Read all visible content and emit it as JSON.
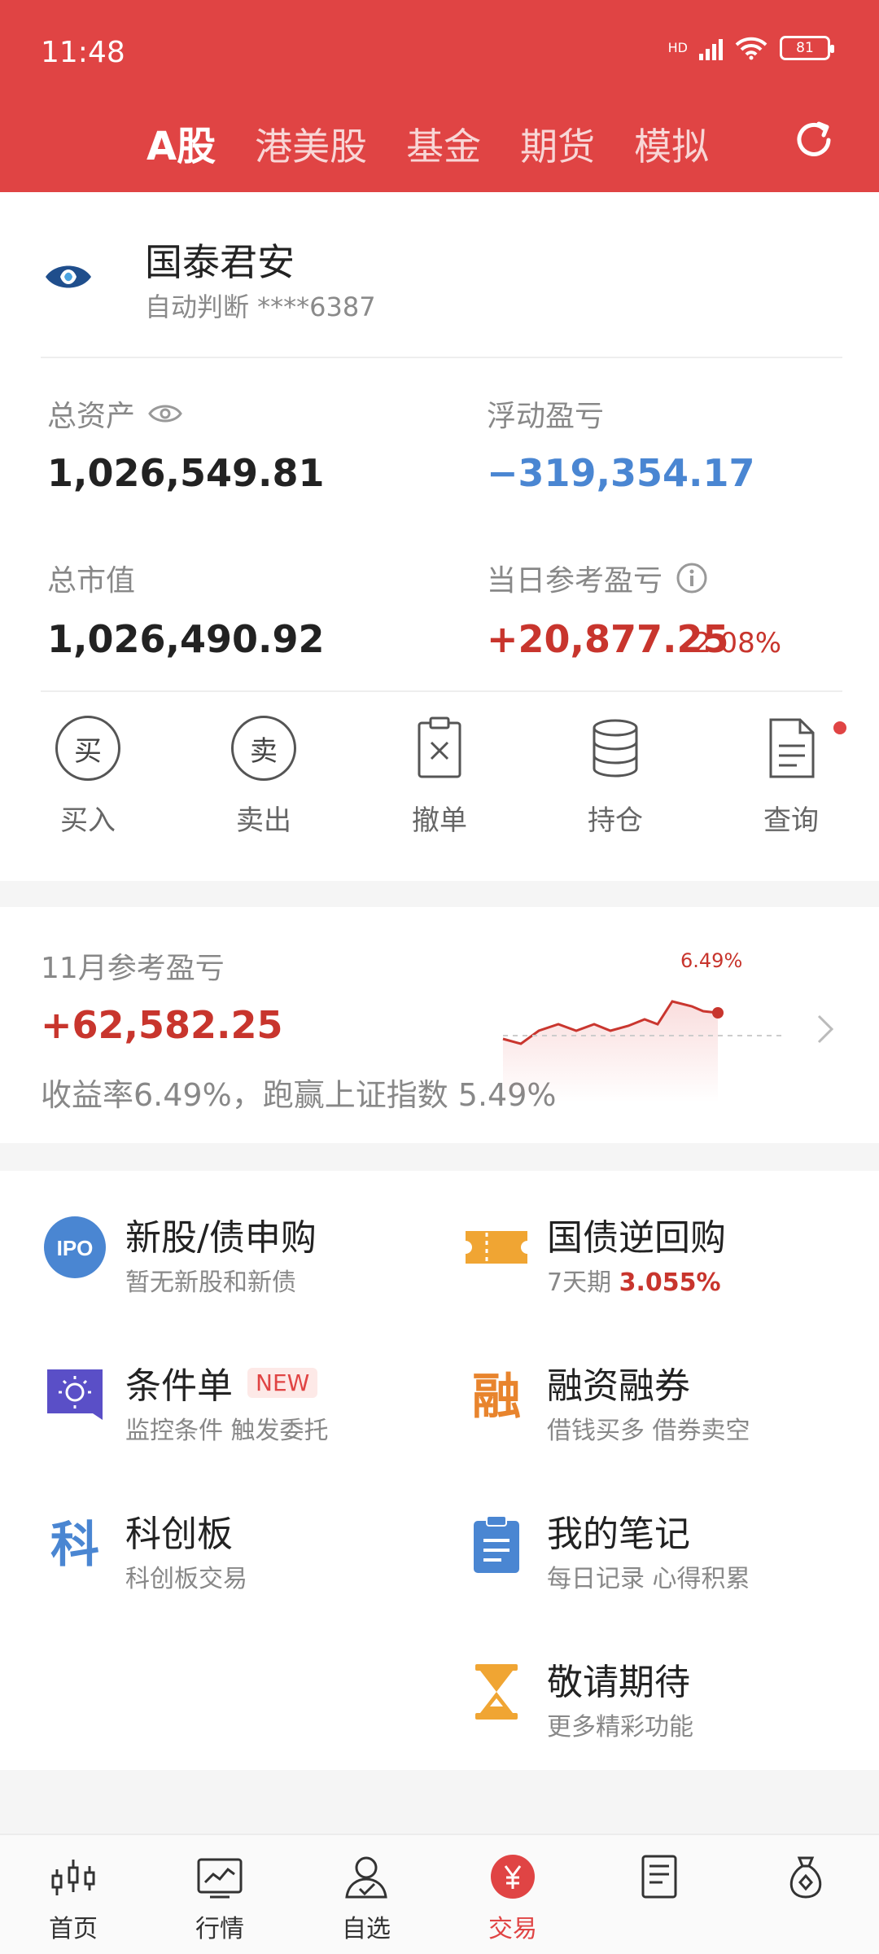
{
  "status": {
    "time": "11:48",
    "signal_label": "HD",
    "battery": "81"
  },
  "tabs": [
    {
      "label": "A股",
      "active": true
    },
    {
      "label": "港美股",
      "active": false
    },
    {
      "label": "基金",
      "active": false
    },
    {
      "label": "期货",
      "active": false
    },
    {
      "label": "模拟",
      "active": false
    }
  ],
  "account": {
    "broker": "国泰君安",
    "subtitle": "自动判断 ****6387"
  },
  "metrics": {
    "total_assets": {
      "label": "总资产",
      "value": "1,026,549.81"
    },
    "floating_pl": {
      "label": "浮动盈亏",
      "value": "−319,354.17"
    },
    "market_value": {
      "label": "总市值",
      "value": "1,026,490.92"
    },
    "today_pl": {
      "label": "当日参考盈亏",
      "value": "+20,877.25",
      "pct": "2.08%"
    }
  },
  "actions": [
    {
      "label": "买入",
      "glyph": "买",
      "icon": "buy-icon"
    },
    {
      "label": "卖出",
      "glyph": "卖",
      "icon": "sell-icon"
    },
    {
      "label": "撤单",
      "icon": "cancel-order-icon"
    },
    {
      "label": "持仓",
      "icon": "holdings-icon"
    },
    {
      "label": "查询",
      "icon": "query-icon"
    }
  ],
  "monthly": {
    "label": "11月参考盈亏",
    "value": "+62,582.25",
    "summary": "收益率6.49%，跑赢上证指数 5.49%",
    "chart_pct": "6.49%"
  },
  "features": [
    {
      "title": "新股/债申购",
      "sub": "暂无新股和新债",
      "icon": "ipo-icon",
      "icon_text": "IPO"
    },
    {
      "title": "国债逆回购",
      "sub": "7天期",
      "sub_highlight": "3.055%",
      "icon": "ticket-icon"
    },
    {
      "title": "条件单",
      "badge": "NEW",
      "sub": "监控条件 触发委托",
      "icon": "condition-order-icon"
    },
    {
      "title": "融资融券",
      "sub": "借钱买多 借券卖空",
      "icon": "margin-icon",
      "icon_text": "融"
    },
    {
      "title": "科创板",
      "sub": "科创板交易",
      "icon": "star-market-icon",
      "icon_text": "科"
    },
    {
      "title": "我的笔记",
      "sub": "每日记录 心得积累",
      "icon": "notes-icon"
    },
    {
      "title": "敬请期待",
      "sub": "更多精彩功能",
      "icon": "hourglass-icon"
    }
  ],
  "nav": [
    {
      "label": "首页",
      "icon": "home-candles-icon"
    },
    {
      "label": "行情",
      "icon": "market-chart-icon"
    },
    {
      "label": "自选",
      "icon": "watchlist-person-icon"
    },
    {
      "label": "交易",
      "icon": "trade-yen-icon",
      "active": true
    },
    {
      "label": "",
      "icon": "news-doc-icon"
    },
    {
      "label": "",
      "icon": "wealth-bag-icon"
    }
  ],
  "colors": {
    "brand_red": "#e04444",
    "up_red": "#c8352d",
    "down_blue": "#4a86d2"
  }
}
